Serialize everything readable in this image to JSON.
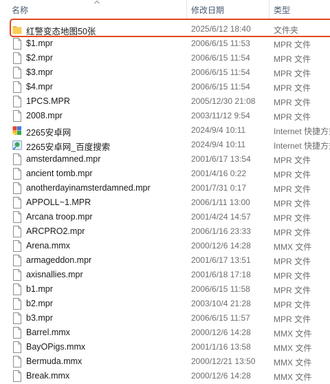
{
  "columns": {
    "name": "名称",
    "date": "修改日期",
    "type": "类型"
  },
  "files": [
    {
      "name": "红警变态地图50张",
      "date": "2025/6/12 18:40",
      "type": "文件夹",
      "icon": "folder-icon",
      "selected": true
    },
    {
      "name": "$1.mpr",
      "date": "2006/6/15 11:53",
      "type": "MPR 文件",
      "icon": "file-icon"
    },
    {
      "name": "$2.mpr",
      "date": "2006/6/15 11:54",
      "type": "MPR 文件",
      "icon": "file-icon"
    },
    {
      "name": "$3.mpr",
      "date": "2006/6/15 11:54",
      "type": "MPR 文件",
      "icon": "file-icon"
    },
    {
      "name": "$4.mpr",
      "date": "2006/6/15 11:54",
      "type": "MPR 文件",
      "icon": "file-icon"
    },
    {
      "name": "1PCS.MPR",
      "date": "2005/12/30 21:08",
      "type": "MPR 文件",
      "icon": "file-icon"
    },
    {
      "name": "2008.mpr",
      "date": "2003/11/12 9:54",
      "type": "MPR 文件",
      "icon": "file-icon"
    },
    {
      "name": "2265安卓网",
      "date": "2024/9/4 10:11",
      "type": "Internet 快捷方式",
      "icon": "internet-shortcut-icon"
    },
    {
      "name": "2265安卓网_百度搜索",
      "date": "2024/9/4 10:11",
      "type": "Internet 快捷方式",
      "icon": "internet-shortcut-green-icon"
    },
    {
      "name": "amsterdamned.mpr",
      "date": "2001/6/17 13:54",
      "type": "MPR 文件",
      "icon": "file-icon"
    },
    {
      "name": "ancient tomb.mpr",
      "date": "2001/4/16 0:22",
      "type": "MPR 文件",
      "icon": "file-icon"
    },
    {
      "name": "anotherdayinamsterdamned.mpr",
      "date": "2001/7/31 0:17",
      "type": "MPR 文件",
      "icon": "file-icon"
    },
    {
      "name": "APPOLL~1.MPR",
      "date": "2006/1/11 13:00",
      "type": "MPR 文件",
      "icon": "file-icon"
    },
    {
      "name": "Arcana troop.mpr",
      "date": "2001/4/24 14:57",
      "type": "MPR 文件",
      "icon": "file-icon"
    },
    {
      "name": "ARCPRO2.mpr",
      "date": "2006/1/16 23:33",
      "type": "MPR 文件",
      "icon": "file-icon"
    },
    {
      "name": "Arena.mmx",
      "date": "2000/12/6 14:28",
      "type": "MMX 文件",
      "icon": "file-icon"
    },
    {
      "name": "armageddon.mpr",
      "date": "2001/6/17 13:51",
      "type": "MPR 文件",
      "icon": "file-icon"
    },
    {
      "name": "axisnallies.mpr",
      "date": "2001/6/18 17:18",
      "type": "MPR 文件",
      "icon": "file-icon"
    },
    {
      "name": "b1.mpr",
      "date": "2006/6/15 11:58",
      "type": "MPR 文件",
      "icon": "file-icon"
    },
    {
      "name": "b2.mpr",
      "date": "2003/10/4 21:28",
      "type": "MPR 文件",
      "icon": "file-icon"
    },
    {
      "name": "b3.mpr",
      "date": "2006/6/15 11:57",
      "type": "MPR 文件",
      "icon": "file-icon"
    },
    {
      "name": "Barrel.mmx",
      "date": "2000/12/6 14:28",
      "type": "MMX 文件",
      "icon": "file-icon"
    },
    {
      "name": "BayOPigs.mmx",
      "date": "2001/1/16 13:58",
      "type": "MMX 文件",
      "icon": "file-icon"
    },
    {
      "name": "Bermuda.mmx",
      "date": "2000/12/21 13:50",
      "type": "MMX 文件",
      "icon": "file-icon"
    },
    {
      "name": "Break.mmx",
      "date": "2000/12/6 14:28",
      "type": "MMX 文件",
      "icon": "file-icon"
    }
  ]
}
